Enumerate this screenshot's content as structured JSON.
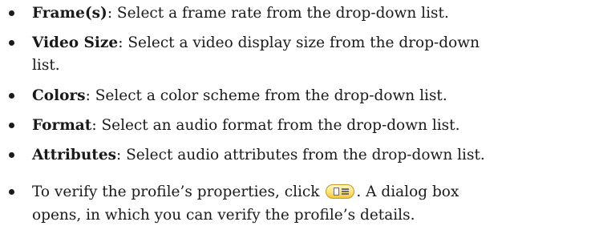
{
  "items": [
    {
      "term": "Frame(s)",
      "desc": ": Select a frame rate from the drop-down list."
    },
    {
      "term": "Video Size",
      "desc": ": Select a video display size from the drop-down",
      "desc_cont": "list."
    },
    {
      "term": "Colors",
      "desc": ": Select a color scheme from the drop-down list."
    },
    {
      "term": "Format",
      "desc": ": Select an audio format from the drop-down list."
    },
    {
      "term": "Attributes",
      "desc": ": Select audio attributes from the drop-down list."
    }
  ],
  "verify": {
    "before": "To verify the profile’s properties, click ",
    "after": ". A dialog box",
    "cont": "opens, in which you can verify the profile’s details.",
    "button_icon": "profile-properties-icon"
  }
}
